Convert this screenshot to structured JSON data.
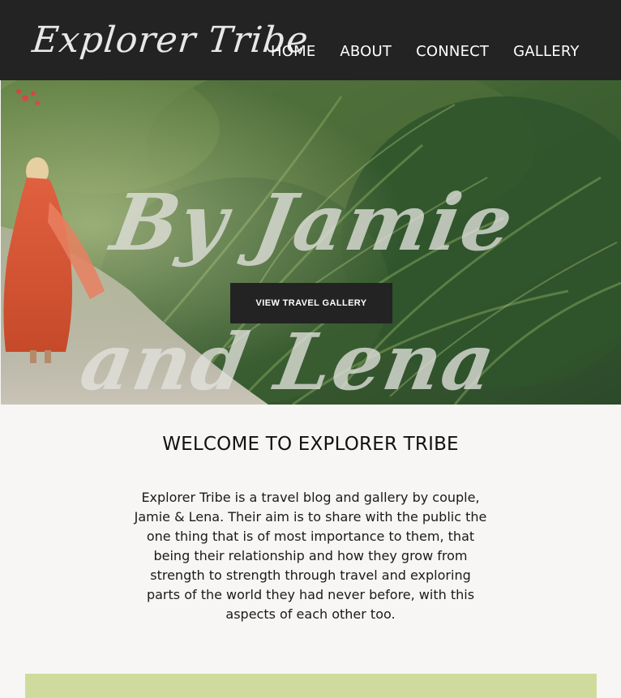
{
  "header": {
    "logo": "Explorer Tribe",
    "nav": [
      "HOME",
      "ABOUT",
      "CONNECT",
      "GALLERY"
    ]
  },
  "hero": {
    "title": "By Jamie and Lena",
    "button_label": "VIEW TRAVEL GALLERY"
  },
  "welcome": {
    "title": "WELCOME TO EXPLORER TRIBE",
    "body": "Explorer Tribe is a travel blog and gallery by couple, Jamie & Lena. Their aim is to share with the public the one thing that is of most importance to them, that being their relationship and how they grow from strength to strength through travel and exploring parts of the world they had never before, with this aspects of each other too."
  },
  "colors": {
    "header_bg": "#232323",
    "page_bg": "#f7f6f4",
    "accent_band": "#cfdb9c",
    "button_bg": "#232323"
  }
}
